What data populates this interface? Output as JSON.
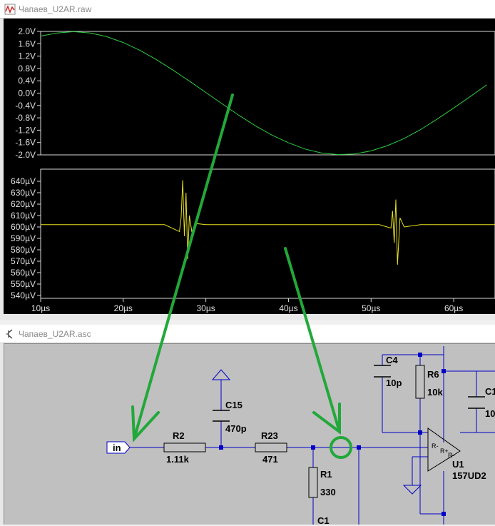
{
  "waveform_window": {
    "title": "Чапаев_U2AR.raw",
    "icon": "waveform-viewer-icon"
  },
  "schematic_window": {
    "title": "Чапаев_U2AR.asc",
    "icon": "schematic-icon"
  },
  "colors": {
    "plot_background": "#000000",
    "trace_top": "#2ecc40",
    "trace_bottom": "#e8e020",
    "axis_text": "#e0e0e0",
    "schematic_background": "#c0c0c0",
    "wire": "#0000c8",
    "annotation_arrow": "#22a83a"
  },
  "chart_data": [
    {
      "type": "line",
      "title": "",
      "xlabel": "",
      "ylabel": "",
      "y_ticks": [
        "2.0V",
        "1.6V",
        "1.2V",
        "0.8V",
        "0.4V",
        "0.0V",
        "-0.4V",
        "-0.8V",
        "-1.2V",
        "-1.6V",
        "-2.0V"
      ],
      "ylim": [
        -2.0,
        2.0
      ],
      "xlim": [
        10,
        65
      ],
      "series": [
        {
          "x": [
            10,
            12,
            14,
            16,
            18,
            20,
            22,
            24,
            26,
            28,
            30,
            32,
            34,
            36,
            38,
            40,
            42,
            44,
            46,
            48,
            50,
            52,
            54,
            56,
            58,
            60,
            62,
            64
          ],
          "y": [
            1.85,
            1.95,
            1.99,
            1.95,
            1.83,
            1.64,
            1.39,
            1.09,
            0.75,
            0.39,
            0.02,
            -0.35,
            -0.72,
            -1.06,
            -1.36,
            -1.61,
            -1.81,
            -1.94,
            -1.99,
            -1.97,
            -1.87,
            -1.7,
            -1.47,
            -1.18,
            -0.84,
            -0.48,
            -0.11,
            0.27
          ]
        }
      ]
    },
    {
      "type": "line",
      "title": "",
      "xlabel": "",
      "ylabel": "",
      "y_ticks": [
        "640µV",
        "630µV",
        "620µV",
        "610µV",
        "600µV",
        "590µV",
        "580µV",
        "570µV",
        "560µV",
        "550µV",
        "540µV"
      ],
      "ylim": [
        540,
        640
      ],
      "x_ticks": [
        "10µs",
        "20µs",
        "30µs",
        "40µs",
        "50µs",
        "60µs"
      ],
      "xlim": [
        10,
        65
      ],
      "series": [
        {
          "x": [
            10,
            25,
            26.8,
            27.0,
            27.2,
            27.4,
            27.6,
            27.8,
            28.0,
            28.3,
            28.8,
            30,
            40,
            51,
            52.4,
            52.6,
            52.8,
            53.0,
            53.2,
            53.5,
            54,
            56,
            65
          ],
          "y": [
            602,
            602,
            596,
            608,
            641,
            592,
            630,
            572,
            610,
            596,
            603,
            602,
            602,
            602,
            599,
            614,
            586,
            624,
            567,
            608,
            600,
            602,
            602
          ]
        }
      ]
    }
  ],
  "schematic": {
    "net_label_in": "in",
    "components": [
      {
        "ref": "R2",
        "value": "1.11k"
      },
      {
        "ref": "C15",
        "value": "470p"
      },
      {
        "ref": "R23",
        "value": "471"
      },
      {
        "ref": "R1",
        "value": "330"
      },
      {
        "ref": "C1",
        "value": ""
      },
      {
        "ref": "C4",
        "value": "10p"
      },
      {
        "ref": "R6",
        "value": "10k"
      },
      {
        "ref": "C1",
        "value": "10"
      },
      {
        "ref": "U1",
        "value": "157UD2"
      }
    ],
    "opamp_pins": [
      "R-",
      "R+",
      "R-"
    ]
  }
}
